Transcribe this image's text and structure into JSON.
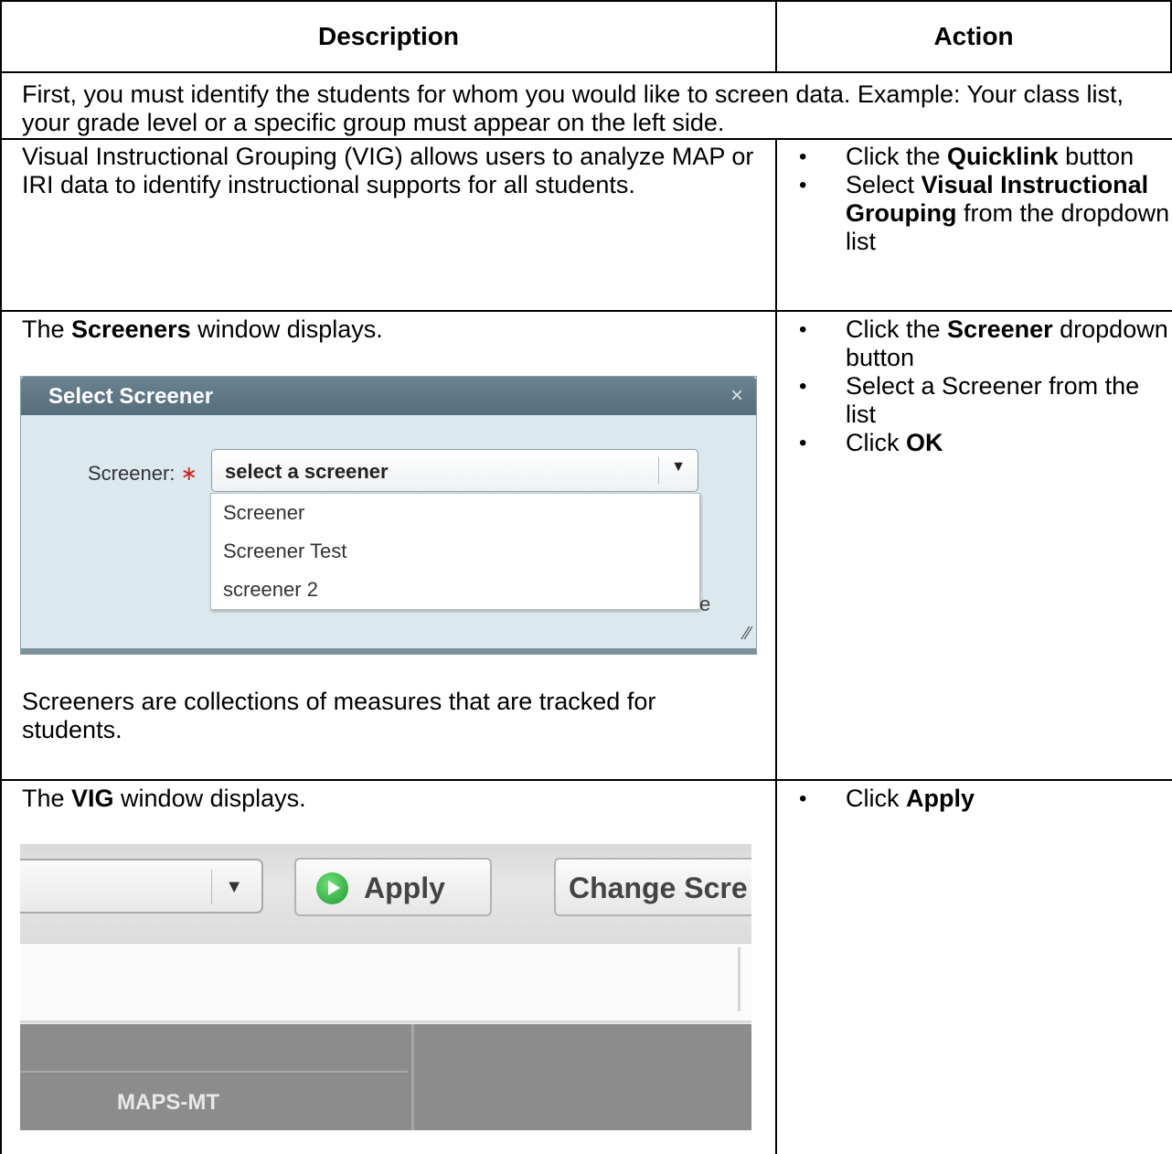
{
  "table": {
    "headers": [
      "Description",
      "Action"
    ],
    "row1": {
      "text": "First, you must identify the students for whom you would like to screen data. Example: Your class list, your grade level or a specific group must appear on the left side."
    },
    "row2": {
      "description": "Visual Instructional Grouping (VIG) allows users to analyze MAP or IRI data to identify instructional supports for all students.",
      "actions": [
        {
          "pre": "Click the ",
          "bold": "Quicklink",
          "post": " button"
        },
        {
          "pre": "Select ",
          "bold": "Visual Instructional Grouping",
          "post": " from the dropdown list"
        }
      ]
    },
    "row3": {
      "intro_pre": "The ",
      "intro_bold": "Screeners",
      "intro_post": " window displays.",
      "note": "Screeners are collections of measures that are tracked for students.",
      "actions": [
        {
          "pre": "Click the ",
          "bold": "Screener",
          "post": " dropdown button"
        },
        {
          "pre": "Select a Screener from the list",
          "bold": "",
          "post": ""
        },
        {
          "pre": "Click ",
          "bold": "OK",
          "post": ""
        }
      ]
    },
    "row4": {
      "intro_pre": "The ",
      "intro_bold": "VIG",
      "intro_post": " window displays.",
      "actions": [
        {
          "pre": "Click ",
          "bold": "Apply",
          "post": ""
        }
      ]
    }
  },
  "screener_dialog": {
    "title": "Select Screener",
    "close_glyph": "×",
    "field_label": "Screener:",
    "required_mark": "∗",
    "selected_value": "select a screener",
    "caret": "▼",
    "options": [
      "Screener",
      "Screener Test",
      "screener 2"
    ],
    "obscured_text": "e",
    "resize_glyph": "⁄⁄"
  },
  "vig_toolbar": {
    "caret": "▼",
    "apply_label": "Apply",
    "change_label": "Change Scre",
    "column_label": "MAPS-MT"
  }
}
